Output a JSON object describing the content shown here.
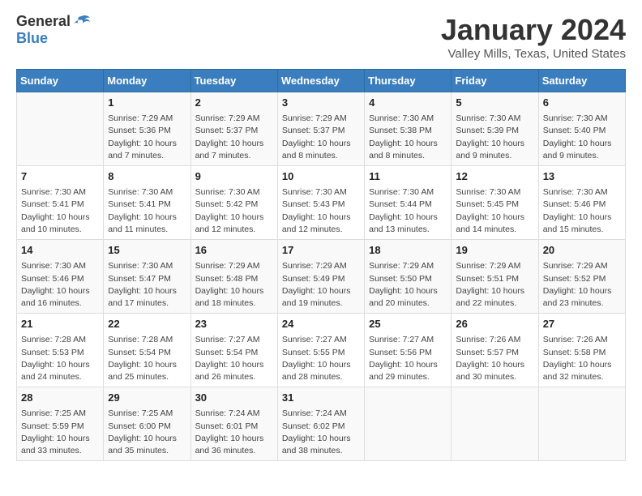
{
  "header": {
    "logo_general": "General",
    "logo_blue": "Blue",
    "title": "January 2024",
    "subtitle": "Valley Mills, Texas, United States"
  },
  "columns": [
    "Sunday",
    "Monday",
    "Tuesday",
    "Wednesday",
    "Thursday",
    "Friday",
    "Saturday"
  ],
  "weeks": [
    [
      {
        "day": "",
        "info": ""
      },
      {
        "day": "1",
        "info": "Sunrise: 7:29 AM\nSunset: 5:36 PM\nDaylight: 10 hours\nand 7 minutes."
      },
      {
        "day": "2",
        "info": "Sunrise: 7:29 AM\nSunset: 5:37 PM\nDaylight: 10 hours\nand 7 minutes."
      },
      {
        "day": "3",
        "info": "Sunrise: 7:29 AM\nSunset: 5:37 PM\nDaylight: 10 hours\nand 8 minutes."
      },
      {
        "day": "4",
        "info": "Sunrise: 7:30 AM\nSunset: 5:38 PM\nDaylight: 10 hours\nand 8 minutes."
      },
      {
        "day": "5",
        "info": "Sunrise: 7:30 AM\nSunset: 5:39 PM\nDaylight: 10 hours\nand 9 minutes."
      },
      {
        "day": "6",
        "info": "Sunrise: 7:30 AM\nSunset: 5:40 PM\nDaylight: 10 hours\nand 9 minutes."
      }
    ],
    [
      {
        "day": "7",
        "info": "Sunrise: 7:30 AM\nSunset: 5:41 PM\nDaylight: 10 hours\nand 10 minutes."
      },
      {
        "day": "8",
        "info": "Sunrise: 7:30 AM\nSunset: 5:41 PM\nDaylight: 10 hours\nand 11 minutes."
      },
      {
        "day": "9",
        "info": "Sunrise: 7:30 AM\nSunset: 5:42 PM\nDaylight: 10 hours\nand 12 minutes."
      },
      {
        "day": "10",
        "info": "Sunrise: 7:30 AM\nSunset: 5:43 PM\nDaylight: 10 hours\nand 12 minutes."
      },
      {
        "day": "11",
        "info": "Sunrise: 7:30 AM\nSunset: 5:44 PM\nDaylight: 10 hours\nand 13 minutes."
      },
      {
        "day": "12",
        "info": "Sunrise: 7:30 AM\nSunset: 5:45 PM\nDaylight: 10 hours\nand 14 minutes."
      },
      {
        "day": "13",
        "info": "Sunrise: 7:30 AM\nSunset: 5:46 PM\nDaylight: 10 hours\nand 15 minutes."
      }
    ],
    [
      {
        "day": "14",
        "info": "Sunrise: 7:30 AM\nSunset: 5:46 PM\nDaylight: 10 hours\nand 16 minutes."
      },
      {
        "day": "15",
        "info": "Sunrise: 7:30 AM\nSunset: 5:47 PM\nDaylight: 10 hours\nand 17 minutes."
      },
      {
        "day": "16",
        "info": "Sunrise: 7:29 AM\nSunset: 5:48 PM\nDaylight: 10 hours\nand 18 minutes."
      },
      {
        "day": "17",
        "info": "Sunrise: 7:29 AM\nSunset: 5:49 PM\nDaylight: 10 hours\nand 19 minutes."
      },
      {
        "day": "18",
        "info": "Sunrise: 7:29 AM\nSunset: 5:50 PM\nDaylight: 10 hours\nand 20 minutes."
      },
      {
        "day": "19",
        "info": "Sunrise: 7:29 AM\nSunset: 5:51 PM\nDaylight: 10 hours\nand 22 minutes."
      },
      {
        "day": "20",
        "info": "Sunrise: 7:29 AM\nSunset: 5:52 PM\nDaylight: 10 hours\nand 23 minutes."
      }
    ],
    [
      {
        "day": "21",
        "info": "Sunrise: 7:28 AM\nSunset: 5:53 PM\nDaylight: 10 hours\nand 24 minutes."
      },
      {
        "day": "22",
        "info": "Sunrise: 7:28 AM\nSunset: 5:54 PM\nDaylight: 10 hours\nand 25 minutes."
      },
      {
        "day": "23",
        "info": "Sunrise: 7:27 AM\nSunset: 5:54 PM\nDaylight: 10 hours\nand 26 minutes."
      },
      {
        "day": "24",
        "info": "Sunrise: 7:27 AM\nSunset: 5:55 PM\nDaylight: 10 hours\nand 28 minutes."
      },
      {
        "day": "25",
        "info": "Sunrise: 7:27 AM\nSunset: 5:56 PM\nDaylight: 10 hours\nand 29 minutes."
      },
      {
        "day": "26",
        "info": "Sunrise: 7:26 AM\nSunset: 5:57 PM\nDaylight: 10 hours\nand 30 minutes."
      },
      {
        "day": "27",
        "info": "Sunrise: 7:26 AM\nSunset: 5:58 PM\nDaylight: 10 hours\nand 32 minutes."
      }
    ],
    [
      {
        "day": "28",
        "info": "Sunrise: 7:25 AM\nSunset: 5:59 PM\nDaylight: 10 hours\nand 33 minutes."
      },
      {
        "day": "29",
        "info": "Sunrise: 7:25 AM\nSunset: 6:00 PM\nDaylight: 10 hours\nand 35 minutes."
      },
      {
        "day": "30",
        "info": "Sunrise: 7:24 AM\nSunset: 6:01 PM\nDaylight: 10 hours\nand 36 minutes."
      },
      {
        "day": "31",
        "info": "Sunrise: 7:24 AM\nSunset: 6:02 PM\nDaylight: 10 hours\nand 38 minutes."
      },
      {
        "day": "",
        "info": ""
      },
      {
        "day": "",
        "info": ""
      },
      {
        "day": "",
        "info": ""
      }
    ]
  ]
}
